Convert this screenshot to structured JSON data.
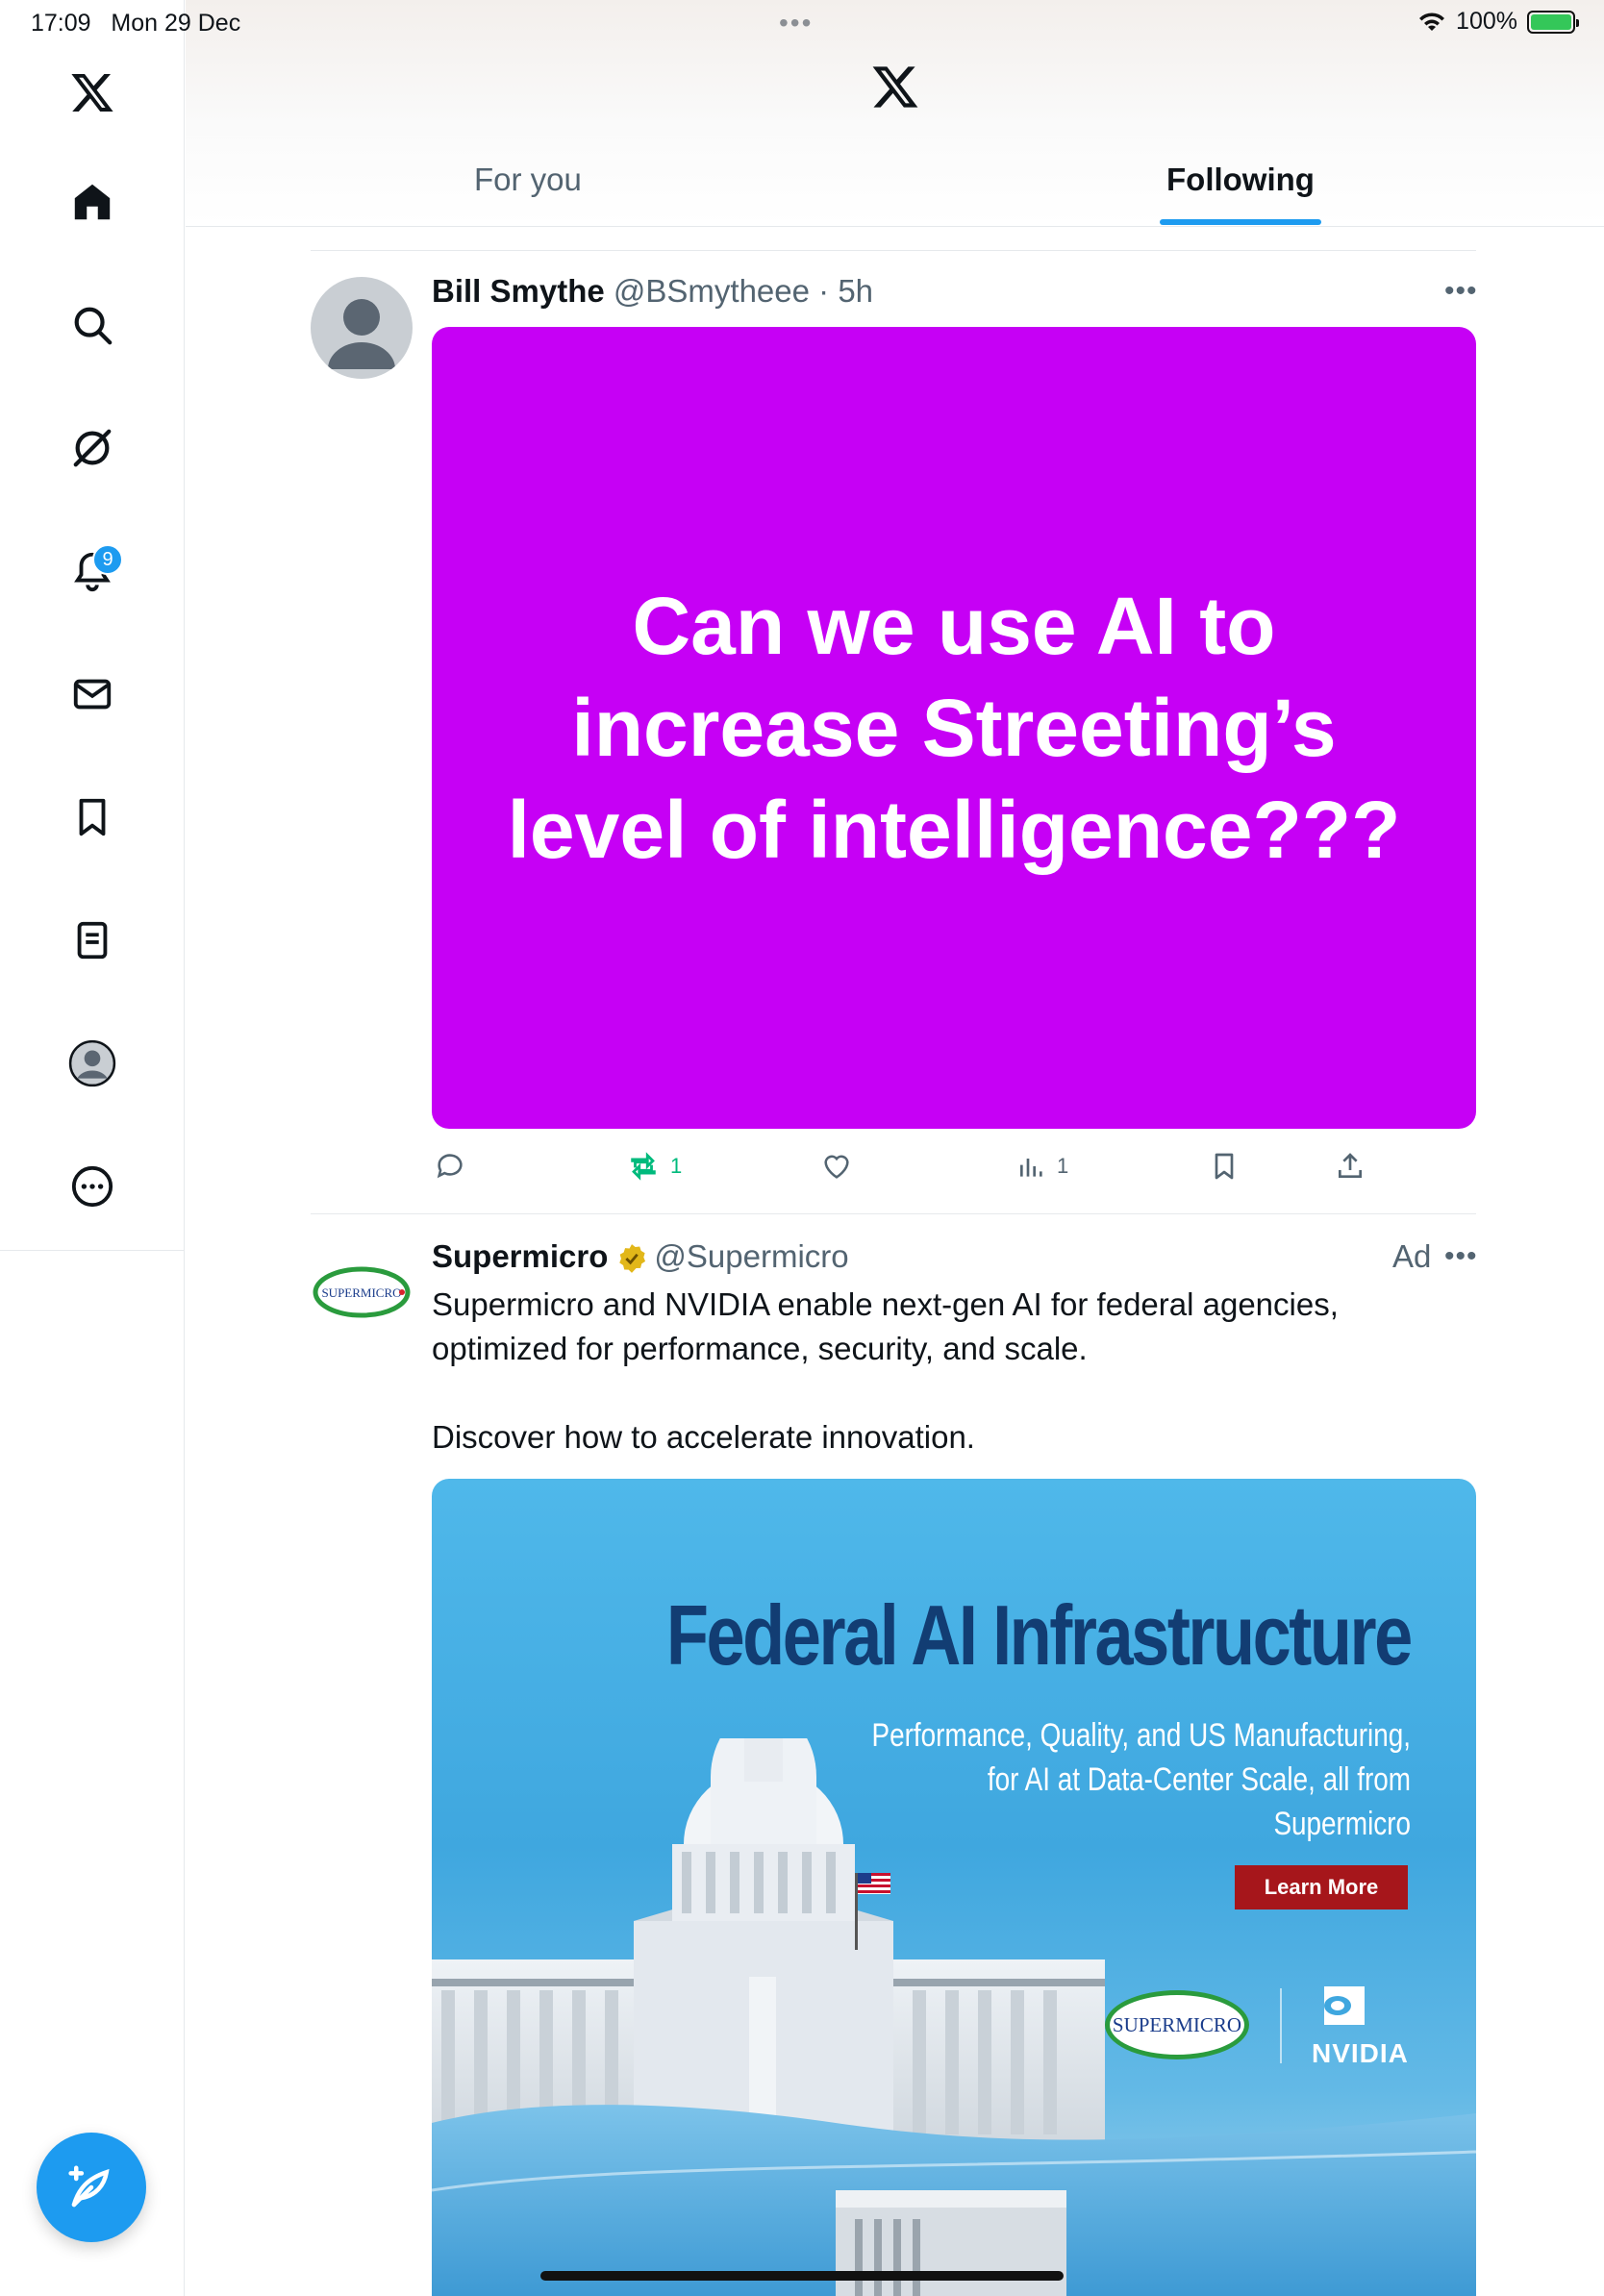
{
  "status_bar": {
    "time": "17:09",
    "date": "Mon 29 Dec",
    "battery": "100%"
  },
  "sidebar": {
    "items": [
      {
        "name": "x-logo-icon"
      },
      {
        "name": "home-icon"
      },
      {
        "name": "search-icon"
      },
      {
        "name": "grok-icon"
      },
      {
        "name": "notifications-icon",
        "badge": "9"
      },
      {
        "name": "messages-icon"
      },
      {
        "name": "bookmarks-icon"
      },
      {
        "name": "lists-icon"
      },
      {
        "name": "profile-icon"
      },
      {
        "name": "more-icon"
      }
    ],
    "compose_icon": "compose-icon"
  },
  "header": {
    "tabs": [
      {
        "label": "For you",
        "selected": false
      },
      {
        "label": "Following",
        "selected": true
      }
    ]
  },
  "tweets": [
    {
      "name": "Bill Smythe",
      "handle": "@BSmytheee",
      "time": "· 5h",
      "image_text": "Can we use AI to increase Streeting’s level of intelligence???",
      "image_color": "#c600f5",
      "actions": {
        "reply": "",
        "retweet": "1",
        "like": "",
        "views": "1"
      }
    },
    {
      "name": "Supermicro",
      "handle": "@Supermicro",
      "ad_label": "Ad",
      "body_line1": "Supermicro and NVIDIA enable next-gen AI for federal agencies,",
      "body_line2": "optimized for performance, security, and scale.",
      "body_line3": "Discover how to accelerate innovation.",
      "avatar_text": "SUPERMICRO",
      "ad_image": {
        "title": "Federal AI Infrastructure",
        "subtitle_line1": "Performance, Quality, and US Manufacturing,",
        "subtitle_line2": "for AI at Data-Center Scale, all from Supermicro",
        "button": "Learn More",
        "logo_supermicro": "SUPERMICRO",
        "logo_nvidia": "NVIDIA"
      }
    }
  ]
}
